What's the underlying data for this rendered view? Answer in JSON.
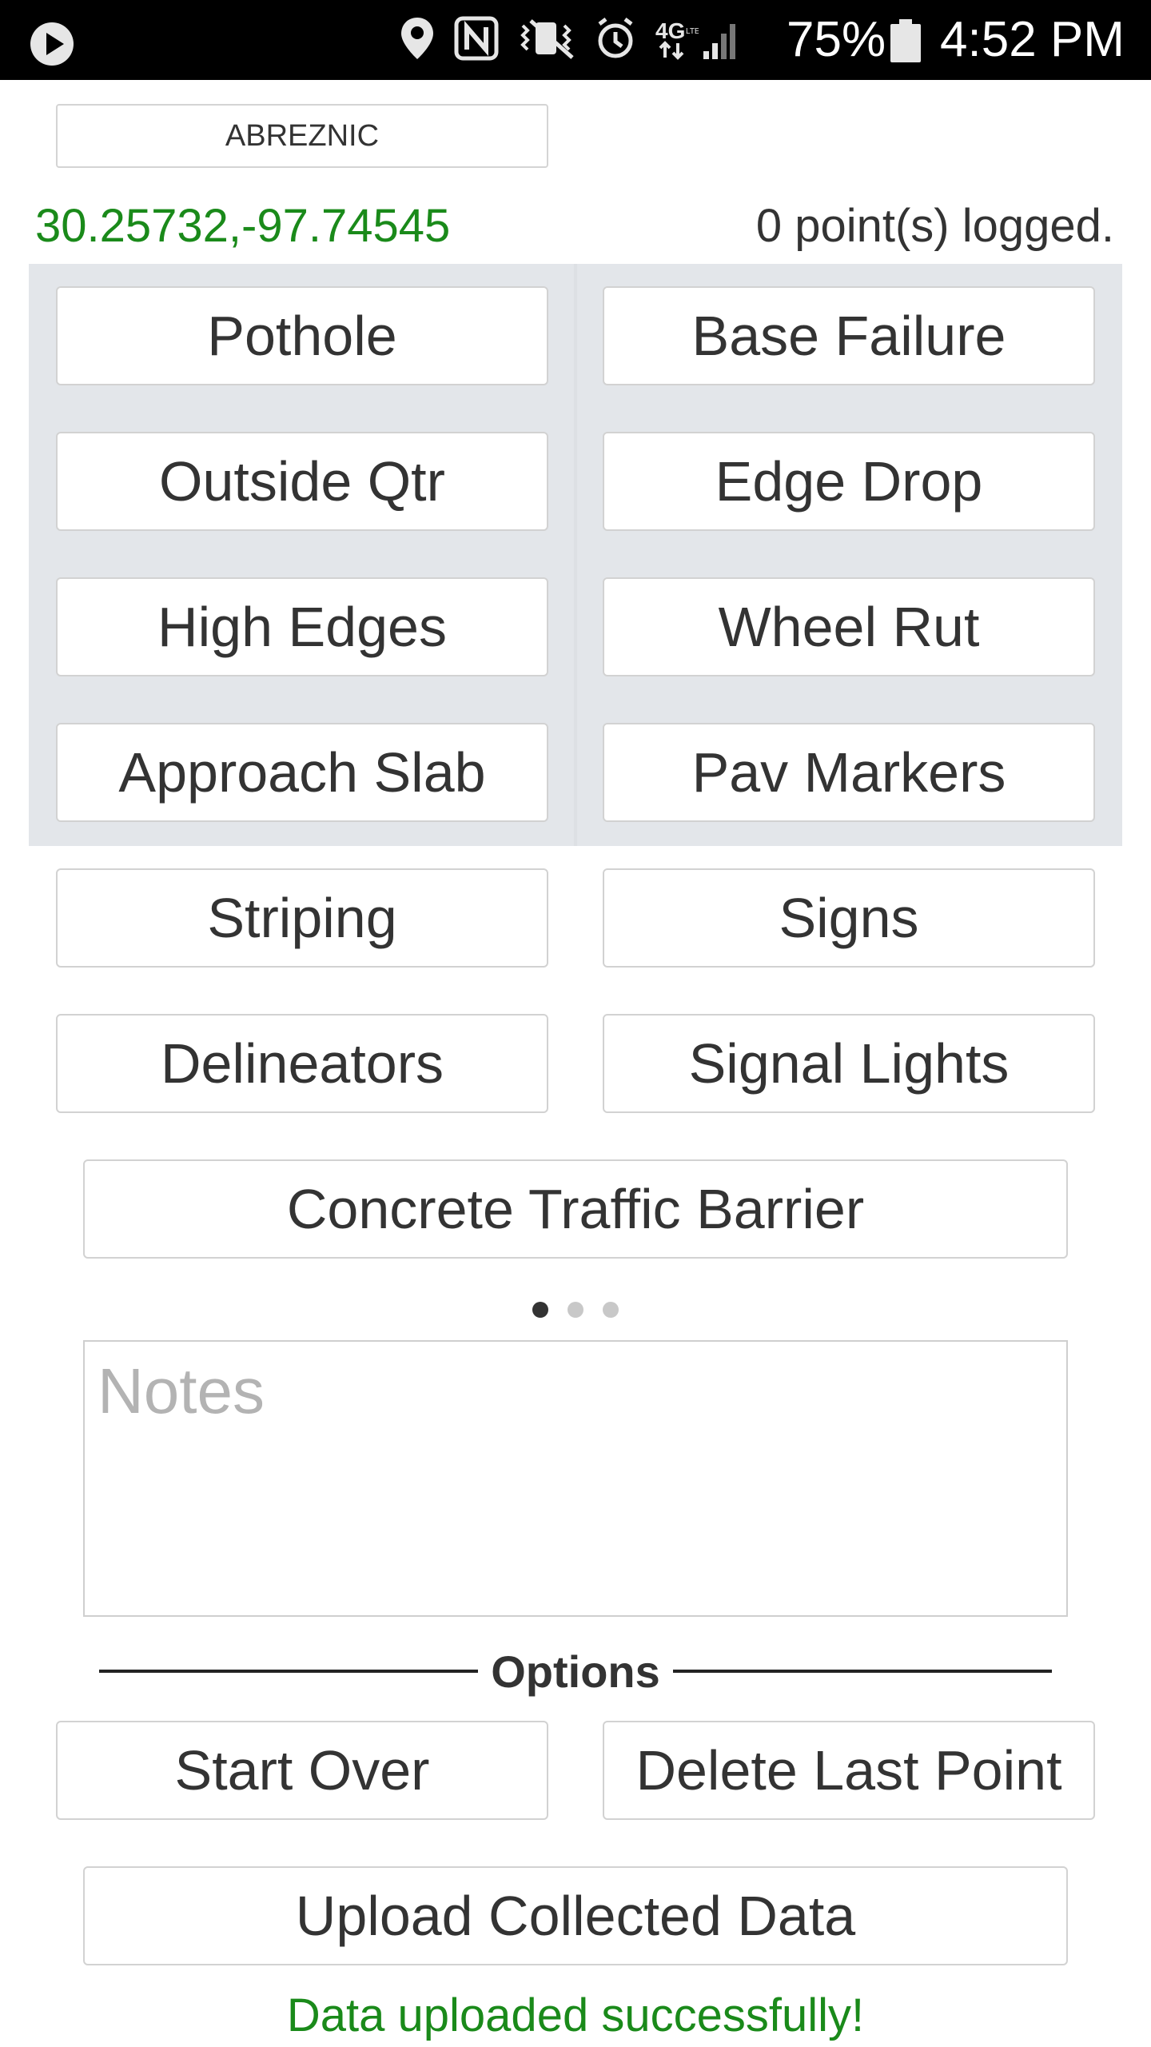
{
  "status_bar": {
    "battery": "75%",
    "time": "4:52 PM",
    "icons": [
      "play-icon",
      "location-icon",
      "nfc-icon",
      "vibrate-icon",
      "alarm-icon",
      "lte-icon",
      "signal-icon",
      "battery-icon"
    ]
  },
  "user": {
    "name": "ABREZNIC"
  },
  "location": {
    "coords": "30.25732,-97.74545",
    "logged_text": "0 point(s) logged."
  },
  "grid": {
    "items": [
      {
        "label": "Pothole"
      },
      {
        "label": "Base Failure"
      },
      {
        "label": "Outside Qtr"
      },
      {
        "label": "Edge Drop"
      },
      {
        "label": "High Edges"
      },
      {
        "label": "Wheel Rut"
      },
      {
        "label": "Approach Slab"
      },
      {
        "label": "Pav Markers"
      },
      {
        "label": "Striping"
      },
      {
        "label": "Signs"
      },
      {
        "label": "Delineators"
      },
      {
        "label": "Signal Lights"
      }
    ],
    "wide_item": "Concrete Traffic Barrier",
    "page_indicator": {
      "pages": 3,
      "current": 1
    }
  },
  "notes": {
    "placeholder": "Notes",
    "value": ""
  },
  "options": {
    "heading": "Options",
    "start_over": "Start Over",
    "delete_last": "Delete Last Point",
    "upload": "Upload Collected Data"
  },
  "message": "Data uploaded successfully!",
  "colors": {
    "success": "#1a8a1a",
    "panel": "#e3e6ea",
    "status_bar": "#000000"
  }
}
